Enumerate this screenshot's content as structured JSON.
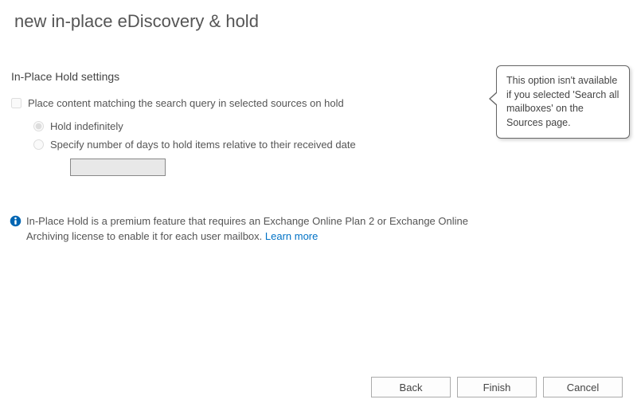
{
  "page": {
    "title": "new in-place eDiscovery & hold"
  },
  "section": {
    "heading": "In-Place Hold settings"
  },
  "hold": {
    "checkbox_label": "Place content matching the search query in selected sources on hold",
    "radio_indefinite": "Hold indefinitely",
    "radio_days": "Specify number of days to hold items relative to their received date",
    "days_value": ""
  },
  "info": {
    "text": "In-Place Hold is a premium feature that requires an Exchange Online Plan 2 or Exchange Online Archiving license to enable it for each user mailbox. ",
    "learn_more": "Learn more"
  },
  "tooltip": {
    "text": "This option isn't available if you selected 'Search all mailboxes' on the Sources page."
  },
  "buttons": {
    "back": "Back",
    "finish": "Finish",
    "cancel": "Cancel"
  }
}
